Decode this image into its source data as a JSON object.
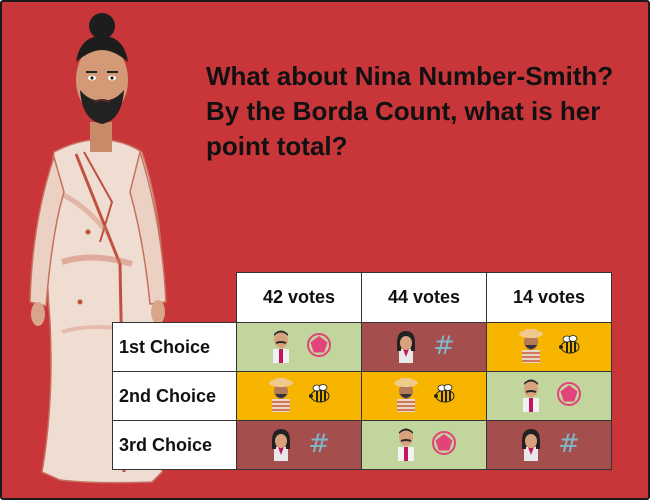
{
  "question": "What about Nina Number-Smith?  By the Borda Count, what is her point total?",
  "columns": [
    "42 votes",
    "44 votes",
    "14 votes"
  ],
  "rows": [
    {
      "label": "1st Choice",
      "cells": [
        "pentagon",
        "hash",
        "bee"
      ]
    },
    {
      "label": "2nd Choice",
      "cells": [
        "bee",
        "bee",
        "pentagon"
      ]
    },
    {
      "label": "3rd Choice",
      "cells": [
        "hash",
        "pentagon",
        "hash"
      ]
    }
  ],
  "candidates": {
    "pentagon": {
      "icon": "pink-pentagon-icon",
      "avatar": "man-with-mustache-avatar",
      "bg": "#c1d59c"
    },
    "hash": {
      "icon": "hash-icon",
      "avatar": "woman-with-bob-avatar",
      "bg": "#a44e4e"
    },
    "bee": {
      "icon": "bee-icon",
      "avatar": "man-with-straw-hat-avatar",
      "bg": "#f7b500"
    }
  },
  "colors": {
    "background": "#c8363a",
    "header_cell": "#ffffff"
  }
}
